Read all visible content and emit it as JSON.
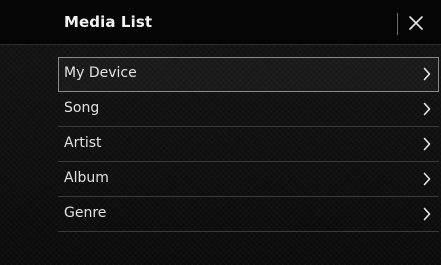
{
  "header": {
    "title": "Media List",
    "close_icon": "close-icon"
  },
  "menu": {
    "selected_index": 0,
    "items": [
      {
        "label": "My Device",
        "icon": "chevron-right-icon"
      },
      {
        "label": "Song",
        "icon": "chevron-right-icon"
      },
      {
        "label": "Artist",
        "icon": "chevron-right-icon"
      },
      {
        "label": "Album",
        "icon": "chevron-right-icon"
      },
      {
        "label": "Genre",
        "icon": "chevron-right-icon"
      }
    ]
  },
  "colors": {
    "background": "#0b0b0b",
    "header_background": "#050505",
    "text": "#e2e2e2",
    "divider": "#3a3a3a",
    "selection_border": "#8a8a8a"
  }
}
